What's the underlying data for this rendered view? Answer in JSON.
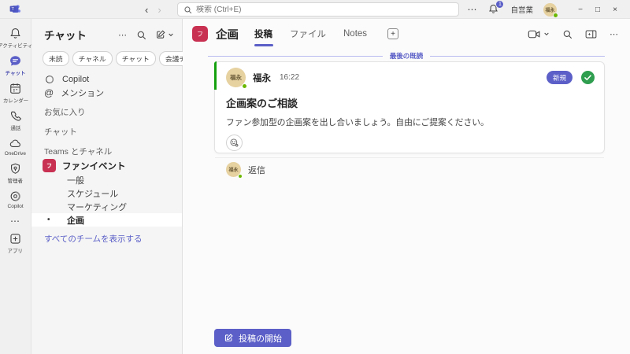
{
  "colors": {
    "accent": "#5b5fc7",
    "team": "#c93152",
    "presence": "#6bb700",
    "unread": "#13a10e"
  },
  "icons": {
    "more": "⋯",
    "at": "@",
    "plus": "+",
    "bullet": "•",
    "back": "‹",
    "forward": "›",
    "minimize": "−",
    "maximize": "□",
    "close": "×"
  },
  "titlebar": {
    "search_placeholder": "検索 (Ctrl+E)",
    "notification_count": "1",
    "org_name": "自営業",
    "user_initials": "福永"
  },
  "rail": {
    "items": [
      {
        "label": "アクティビティ"
      },
      {
        "label": "チャット"
      },
      {
        "label": "カレンダー"
      },
      {
        "label": "通話"
      },
      {
        "label": "OneDrive"
      },
      {
        "label": "管理者"
      },
      {
        "label": "Copilot"
      }
    ],
    "apps_label": "アプリ"
  },
  "sidebar": {
    "title": "チャット",
    "filters": [
      {
        "label": "未読"
      },
      {
        "label": "チャネル"
      },
      {
        "label": "チャット"
      },
      {
        "label": "会議チャット"
      }
    ],
    "pinned": [
      {
        "label": "Copilot"
      },
      {
        "label": "メンション"
      }
    ],
    "section_favorites": "お気に入り",
    "section_chat": "チャット",
    "section_teams": "Teams とチャネル",
    "team": {
      "name": "ファンイベント",
      "avatar_text": "フ"
    },
    "channels": [
      {
        "name": "一般"
      },
      {
        "name": "スケジュール"
      },
      {
        "name": "マーケティング"
      },
      {
        "name": "企画"
      }
    ],
    "show_all_teams": "すべてのチームを表示する"
  },
  "channel": {
    "avatar_text": "フ",
    "title": "企画",
    "tabs": [
      {
        "label": "投稿"
      },
      {
        "label": "ファイル"
      },
      {
        "label": "Notes"
      }
    ],
    "last_read": "最後の既読"
  },
  "post": {
    "author": "福永",
    "avatar_text": "福永",
    "time": "16:22",
    "new_badge": "新規",
    "title": "企画案のご相談",
    "body": "ファン参加型の企画案を出し合いましょう。自由にご提案ください。",
    "reply": "返信"
  },
  "composer": {
    "start_post": "投稿の開始"
  }
}
